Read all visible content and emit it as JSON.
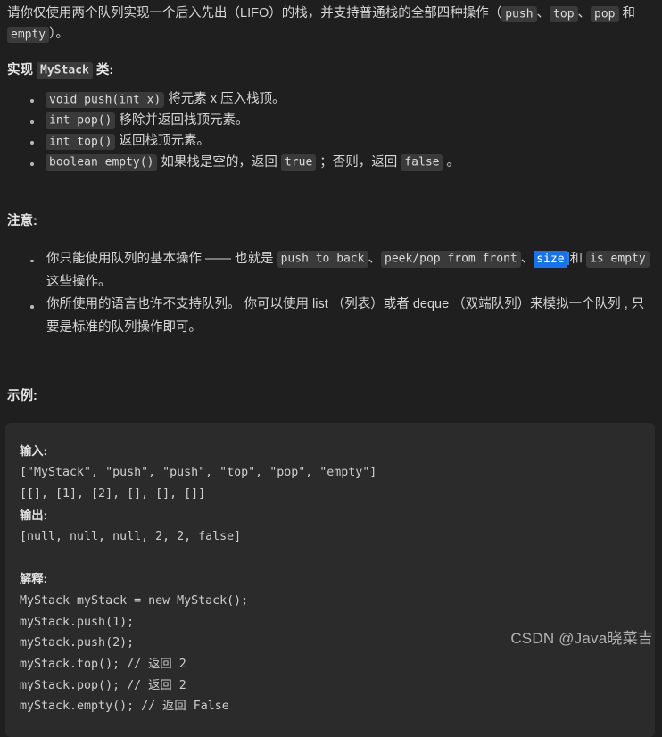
{
  "colors": {
    "page_background": "#1f1f1f",
    "code_block_background": "#2b2b2b",
    "inline_code_background": "#3a3a3a",
    "body_text": "#d6d6d6",
    "selection_highlight": "#1773e6",
    "caret": "#2a7ce8",
    "watermark_text": "#bfbfbf"
  },
  "intro": {
    "part1": "请你仅使用两个队列实现一个后入先出（LIFO）的栈，并支持普通栈的全部四种操作（",
    "code_push": "push",
    "sep1": "、",
    "code_top": "top",
    "sep2": "、",
    "code_pop": "pop",
    "sep3": " 和 ",
    "code_empty": "empty",
    "part_end": "）。"
  },
  "implement": {
    "prefix": "实现 ",
    "class_name": "MyStack",
    "suffix": " 类:"
  },
  "methods": [
    {
      "signature": "void push(int x)",
      "desc": " 将元素 x 压入栈顶。"
    },
    {
      "signature": "int pop()",
      "desc": " 移除并返回栈顶元素。"
    },
    {
      "signature": "int top()",
      "desc": " 返回栈顶元素。"
    },
    {
      "signature": "boolean empty()",
      "desc_a": " 如果栈是空的，返回 ",
      "code_true": "true",
      "desc_b": " ；否则，返回 ",
      "code_false": "false",
      "desc_c": " 。"
    }
  ],
  "notes": {
    "heading": "注意:",
    "item1": {
      "text_a": "你只能使用队列的基本操作 —— 也就是 ",
      "code_1": "push to back",
      "sep_1": "、",
      "code_2": "peek/pop from front",
      "sep_2": "、",
      "code_3_selected": "size",
      "sep_3": "和 ",
      "code_4": "is empty",
      "text_b": " 这些操作。"
    },
    "item2": "你所使用的语言也许不支持队列。 你可以使用 list （列表）或者 deque （双端队列）来模拟一个队列 , 只要是标准的队列操作即可。"
  },
  "example": {
    "heading": "示例:",
    "input_label": "输入:",
    "input_line1": "[\"MyStack\", \"push\", \"push\", \"top\", \"pop\", \"empty\"]",
    "input_line2": "[[], [1], [2], [], [], []]",
    "output_label": "输出:",
    "output_line1": "[null, null, null, 2, 2, false]",
    "explain_label": "解释:",
    "explain_lines": [
      "MyStack myStack = new MyStack();",
      "myStack.push(1);",
      "myStack.push(2);",
      "myStack.top(); // 返回 2",
      "myStack.pop(); // 返回 2",
      "myStack.empty(); // 返回 False"
    ]
  },
  "watermark": "CSDN @Java晓菜吉"
}
